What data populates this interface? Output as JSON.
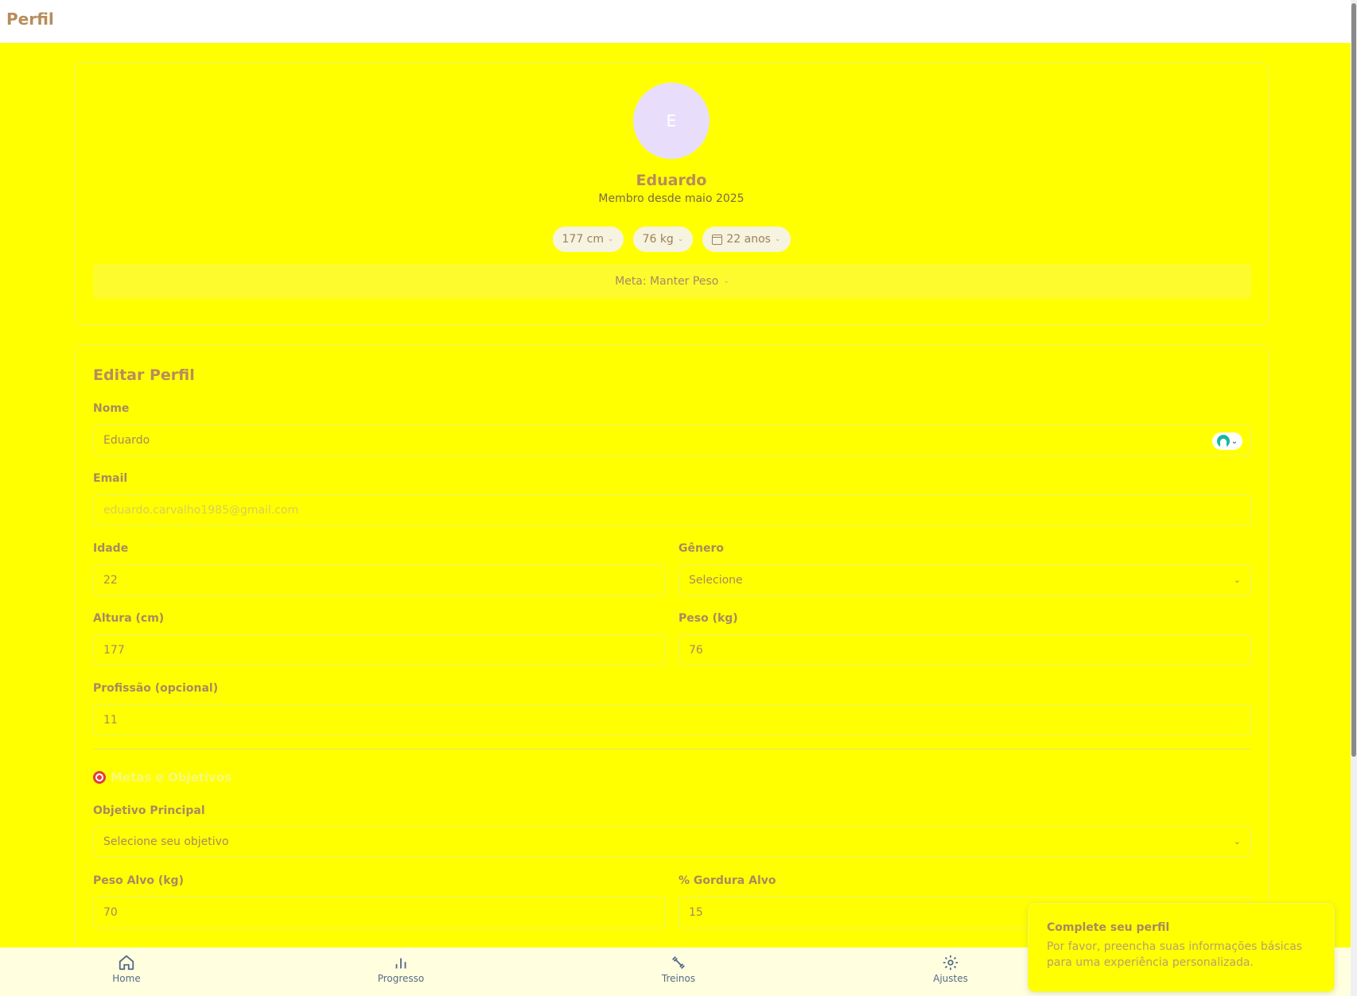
{
  "header": {
    "title": "Perfil"
  },
  "profile": {
    "avatar_initial": "E",
    "name": "Eduardo",
    "member_since": "Membro desde maio 2025",
    "pills": {
      "height": "177 cm",
      "weight": "76 kg",
      "age": "22 anos"
    },
    "goal": "Meta: Manter Peso"
  },
  "edit": {
    "title": "Editar Perfil",
    "name_label": "Nome",
    "name_value": "Eduardo",
    "email_label": "Email",
    "email_value": "eduardo.carvalho1985@gmail.com",
    "age_label": "Idade",
    "age_value": "22",
    "gender_label": "Gênero",
    "gender_value": "Selecione",
    "height_label": "Altura (cm)",
    "height_value": "177",
    "weight_label": "Peso (kg)",
    "weight_value": "76",
    "profession_label": "Profissão (opcional)",
    "profession_value": "11"
  },
  "goals": {
    "title": "Metas e Objetivos",
    "objective_label": "Objetivo Principal",
    "objective_value": "Selecione seu objetivo",
    "target_weight_label": "Peso Alvo (kg)",
    "target_weight_value": "70",
    "target_fat_label": "% Gordura Alvo",
    "target_fat_value": "15"
  },
  "nav": {
    "home": "Home",
    "progress": "Progresso",
    "workouts": "Treinos",
    "settings": "Ajustes"
  },
  "toast": {
    "title": "Complete seu perfil",
    "message": "Por favor, preencha suas informações básicas para uma experiência personalizada."
  }
}
